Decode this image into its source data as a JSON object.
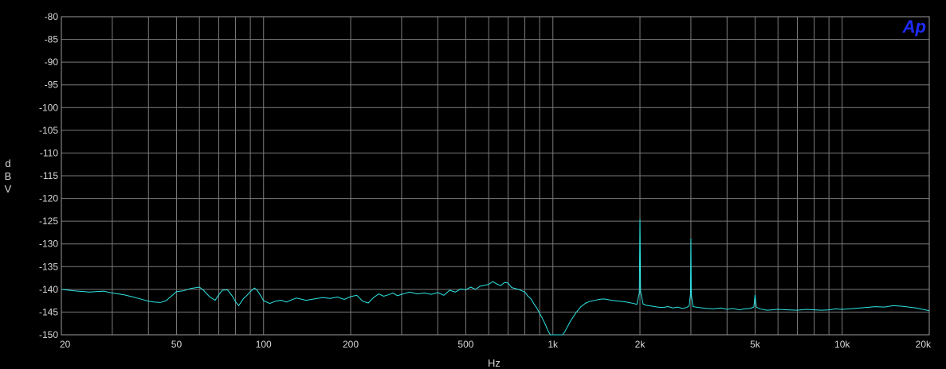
{
  "chart_data": {
    "type": "line",
    "xlabel": "Hz",
    "ylabel_letters": [
      "d",
      "B",
      "V"
    ],
    "x_scale": "log",
    "xlim": [
      20,
      20000
    ],
    "ylim": [
      -150,
      -80
    ],
    "grid": true,
    "logo_text": "Ap",
    "y_ticks": [
      -80,
      -85,
      -90,
      -95,
      -100,
      -105,
      -110,
      -115,
      -120,
      -125,
      -130,
      -135,
      -140,
      -145,
      -150
    ],
    "x_ticks": [
      {
        "value": 20,
        "label": "20"
      },
      {
        "value": 50,
        "label": "50"
      },
      {
        "value": 100,
        "label": "100"
      },
      {
        "value": 200,
        "label": "200"
      },
      {
        "value": 500,
        "label": "500"
      },
      {
        "value": 1000,
        "label": "1k"
      },
      {
        "value": 2000,
        "label": "2k"
      },
      {
        "value": 5000,
        "label": "5k"
      },
      {
        "value": 10000,
        "label": "10k"
      },
      {
        "value": 20000,
        "label": "20k"
      }
    ],
    "colors": {
      "background": "#000000",
      "grid": "#7a7a7a",
      "trace": "#2ee6e6",
      "text": "#d8d8d8",
      "logo": "#1f2bff"
    },
    "series": [
      {
        "x": [
          20,
          22,
          25,
          28,
          30,
          33,
          35,
          38,
          40,
          42,
          44,
          46,
          48,
          50,
          53,
          56,
          60,
          62,
          65,
          68,
          70,
          72,
          75,
          78,
          80,
          82,
          85,
          88,
          90,
          93,
          95,
          98,
          100,
          105,
          110,
          115,
          120,
          125,
          130,
          140,
          150,
          160,
          170,
          180,
          190,
          200,
          210,
          220,
          230,
          240,
          250,
          260,
          270,
          280,
          290,
          300,
          320,
          340,
          360,
          380,
          400,
          420,
          440,
          460,
          480,
          500,
          520,
          540,
          560,
          580,
          600,
          620,
          640,
          660,
          680,
          700,
          720,
          740,
          760,
          780,
          800,
          820,
          840,
          860,
          880,
          900,
          920,
          940,
          960,
          980,
          1000,
          1020,
          1050,
          1080,
          1100,
          1150,
          1200,
          1250,
          1300,
          1350,
          1400,
          1450,
          1500,
          1600,
          1700,
          1800,
          1900,
          1950,
          1990,
          2000,
          2010,
          2050,
          2100,
          2200,
          2300,
          2400,
          2500,
          2600,
          2700,
          2800,
          2900,
          2960,
          2990,
          3000,
          3010,
          3050,
          3200,
          3400,
          3600,
          3800,
          4000,
          4200,
          4400,
          4600,
          4800,
          4950,
          5000,
          5050,
          5200,
          5500,
          6000,
          6500,
          7000,
          7500,
          8000,
          8500,
          9000,
          9500,
          10000,
          11000,
          12000,
          13000,
          14000,
          15000,
          16000,
          17000,
          18000,
          19000,
          20000
        ],
        "y": [
          -140,
          -140.3,
          -140.6,
          -140.4,
          -140.8,
          -141.2,
          -141.6,
          -142.2,
          -142.6,
          -142.8,
          -142.9,
          -142.5,
          -141.5,
          -140.5,
          -140.3,
          -139.8,
          -139.5,
          -140.2,
          -141.6,
          -142.4,
          -141.2,
          -140.2,
          -140.1,
          -141.5,
          -142.7,
          -143.6,
          -142.1,
          -141.2,
          -140.5,
          -139.7,
          -140.2,
          -141.5,
          -142.5,
          -143.1,
          -142.6,
          -142.4,
          -142.8,
          -142.3,
          -141.9,
          -142.4,
          -142.1,
          -141.8,
          -142.0,
          -141.7,
          -142.2,
          -141.6,
          -141.3,
          -142.6,
          -143.0,
          -141.8,
          -141.0,
          -141.5,
          -141.2,
          -140.8,
          -141.4,
          -141.1,
          -140.6,
          -141.0,
          -140.8,
          -141.1,
          -140.7,
          -141.3,
          -140.2,
          -140.6,
          -139.9,
          -140.1,
          -139.5,
          -140.0,
          -139.3,
          -139.1,
          -138.9,
          -138.3,
          -138.8,
          -139.2,
          -138.5,
          -138.6,
          -139.6,
          -139.8,
          -140.0,
          -140.3,
          -140.6,
          -141.5,
          -142.1,
          -143.2,
          -144.1,
          -145.3,
          -146.4,
          -147.6,
          -149.0,
          -150.0,
          -150.0,
          -150.0,
          -150.0,
          -150.0,
          -149.3,
          -147.0,
          -145.2,
          -143.8,
          -143.0,
          -142.6,
          -142.4,
          -142.2,
          -142.1,
          -142.4,
          -142.6,
          -142.8,
          -143.1,
          -143.3,
          -140.8,
          -124.5,
          -140.5,
          -143.2,
          -143.5,
          -143.7,
          -143.9,
          -144.0,
          -143.8,
          -144.1,
          -143.9,
          -144.2,
          -144.0,
          -143.6,
          -141.0,
          -128.8,
          -141.2,
          -143.8,
          -144.0,
          -144.2,
          -144.3,
          -144.1,
          -144.4,
          -144.2,
          -144.5,
          -144.3,
          -144.2,
          -143.9,
          -141.2,
          -143.9,
          -144.3,
          -144.6,
          -144.4,
          -144.5,
          -144.6,
          -144.4,
          -144.5,
          -144.6,
          -144.5,
          -144.3,
          -144.4,
          -144.2,
          -144.0,
          -143.8,
          -143.9,
          -143.6,
          -143.7,
          -143.9,
          -144.1,
          -144.4,
          -144.7
        ]
      }
    ]
  }
}
